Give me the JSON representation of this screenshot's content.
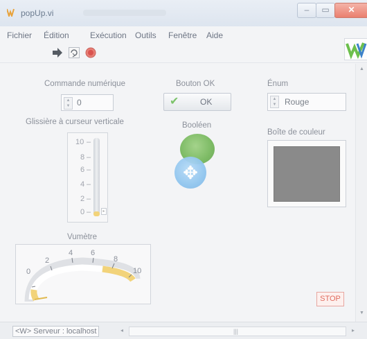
{
  "window": {
    "title": "popUp.vi"
  },
  "menu": {
    "items": [
      "Fichier",
      "Édition",
      "Exécution",
      "Outils",
      "Fenêtre",
      "Aide"
    ]
  },
  "toolbar": {
    "buttons": [
      "run-arrow-icon",
      "run-continuously-icon",
      "abort-icon"
    ]
  },
  "panel": {
    "numeric_control": {
      "label": "Commande numérique",
      "value": "0"
    },
    "slider": {
      "label": "Glissière à curseur verticale",
      "ticks": [
        "10",
        "8",
        "6",
        "4",
        "2",
        "0"
      ],
      "value": 0
    },
    "ok_button": {
      "label": "Bouton OK",
      "caption": "OK"
    },
    "boolean": {
      "label": "Booléen",
      "color": "#7dbb65"
    },
    "enum": {
      "label": "Énum",
      "value": "Rouge"
    },
    "color_box": {
      "label": "Boîte de couleur",
      "color": "#8a8a8a"
    },
    "meter": {
      "label": "Vumètre",
      "ticks": [
        "0",
        "2",
        "4",
        "6",
        "8",
        "10"
      ],
      "value": 0
    },
    "stop_button": {
      "label": "STOP"
    }
  },
  "status": {
    "text": "<W> Serveur : localhost"
  },
  "colors": {
    "accent_green": "#7dbb65",
    "stop_red": "#e06b5e",
    "fill_yellow": "#f2d37a"
  }
}
